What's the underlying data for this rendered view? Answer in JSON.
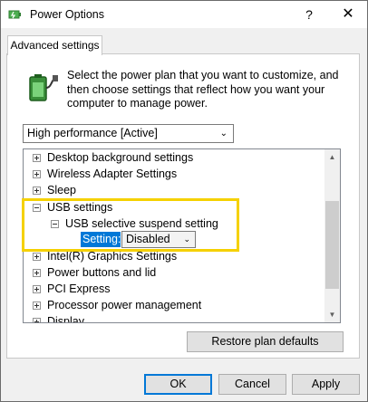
{
  "window": {
    "title": "Power Options",
    "help_label": "?",
    "close_label": "✕"
  },
  "tab": {
    "label": "Advanced settings"
  },
  "description": "Select the power plan that you want to customize, and then choose settings that reflect how you want your computer to manage power.",
  "plan": {
    "selected": "High performance [Active]"
  },
  "tree": {
    "items": [
      {
        "label": "Desktop background settings",
        "state": "collapsed"
      },
      {
        "label": "Wireless Adapter Settings",
        "state": "collapsed"
      },
      {
        "label": "Sleep",
        "state": "collapsed"
      },
      {
        "label": "USB settings",
        "state": "expanded"
      },
      {
        "label": "USB selective suspend setting",
        "state": "expanded"
      },
      {
        "label": "Intel(R) Graphics Settings",
        "state": "collapsed"
      },
      {
        "label": "Power buttons and lid",
        "state": "collapsed"
      },
      {
        "label": "PCI Express",
        "state": "collapsed"
      },
      {
        "label": "Processor power management",
        "state": "collapsed"
      },
      {
        "label": "Display",
        "state": "collapsed"
      }
    ],
    "setting": {
      "label": "Setting:",
      "value": "Disabled"
    }
  },
  "buttons": {
    "restore": "Restore plan defaults",
    "ok": "OK",
    "cancel": "Cancel",
    "apply": "Apply"
  },
  "colors": {
    "highlight": "#f5d100",
    "selection": "#0078d7"
  }
}
